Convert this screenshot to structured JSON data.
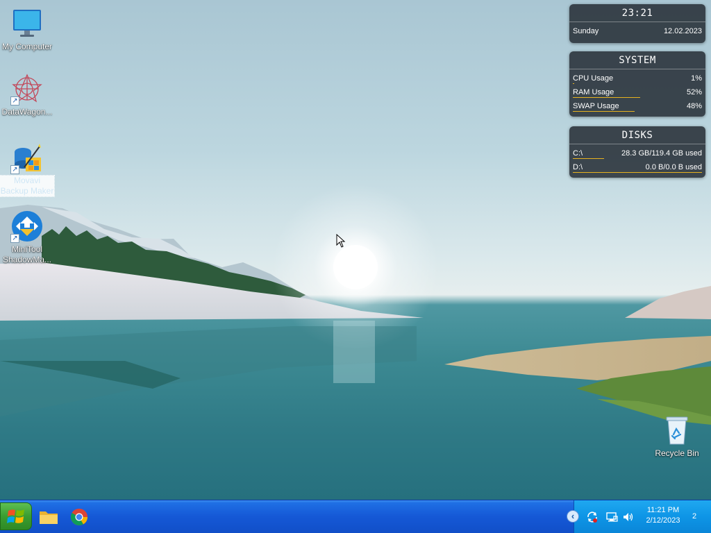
{
  "desktop_icons": [
    {
      "label": "My Computer",
      "icon": "monitor-icon"
    },
    {
      "label": "DataWagon...",
      "icon": "datawagon-icon"
    },
    {
      "label": "Movavi Backup Maker",
      "icon": "backup-wizard-icon"
    },
    {
      "label": "MiniTool ShadowMa...",
      "icon": "minitool-shadowmaker-icon"
    },
    {
      "label": "Recycle Bin",
      "icon": "recycle-bin-icon"
    }
  ],
  "clock_widget": {
    "time": "23:21",
    "day": "Sunday",
    "date": "12.02.2023"
  },
  "system_widget": {
    "title": "SYSTEM",
    "rows": [
      {
        "label": "CPU Usage",
        "value": "1%",
        "fill": 0.01
      },
      {
        "label": "RAM Usage",
        "value": "52%",
        "fill": 0.52
      },
      {
        "label": "SWAP Usage",
        "value": "48%",
        "fill": 0.48
      }
    ]
  },
  "disks_widget": {
    "title": "DISKS",
    "rows": [
      {
        "label": "C:\\",
        "value": "28.3 GB/119.4 GB used",
        "fill": 0.24
      },
      {
        "label": "D:\\",
        "value": "0.0 B/0.0 B used",
        "fill": 1.0
      }
    ]
  },
  "taskbar": {
    "start_icon": "windows-logo-icon",
    "pinned": [
      {
        "name": "file-explorer",
        "icon": "folder-icon"
      },
      {
        "name": "chrome",
        "icon": "chrome-icon"
      }
    ],
    "tray": {
      "time": "11:21 PM",
      "date": "2/12/2023",
      "notification_count": "2",
      "icons": [
        "sync-icon",
        "network-icon",
        "volume-icon"
      ]
    }
  },
  "colors": {
    "taskbar": "#1558d6",
    "tray": "#0e95e6",
    "start": "#3a9d30",
    "widget_bar": "#e7b21f"
  }
}
